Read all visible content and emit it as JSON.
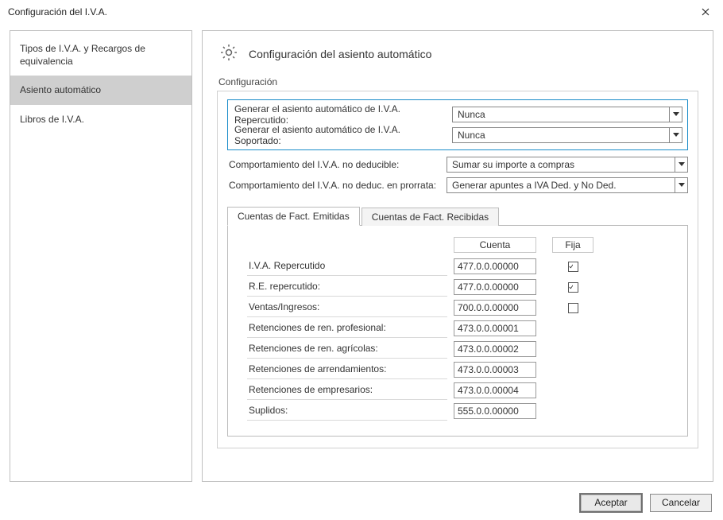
{
  "window": {
    "title": "Configuración del I.V.A."
  },
  "sidebar": {
    "items": [
      {
        "label": "Tipos de I.V.A. y Recargos de equivalencia",
        "selected": false
      },
      {
        "label": "Asiento automático",
        "selected": true
      },
      {
        "label": "Libros de I.V.A.",
        "selected": false
      }
    ]
  },
  "page": {
    "title": "Configuración del asiento automático",
    "section_label": "Configuración",
    "fields": {
      "repercutido_label": "Generar el asiento automático de I.V.A. Repercutido:",
      "repercutido_value": "Nunca",
      "soportado_label": "Generar el asiento automático de I.V.A. Soportado:",
      "soportado_value": "Nunca",
      "no_deduc_label": "Comportamiento del I.V.A. no deducible:",
      "no_deduc_value": "Sumar su importe a compras",
      "prorrata_label": "Comportamiento del I.V.A. no deduc. en prorrata:",
      "prorrata_value": "Generar apuntes a IVA Ded. y No Ded."
    },
    "tabs": [
      {
        "label": "Cuentas de Fact. Emitidas",
        "active": true
      },
      {
        "label": "Cuentas de Fact. Recibidas",
        "active": false
      }
    ],
    "columns": {
      "cuenta": "Cuenta",
      "fija": "Fija"
    },
    "accounts": [
      {
        "label": "I.V.A. Repercutido",
        "cuenta": "477.0.0.00000",
        "fija": true
      },
      {
        "label": "R.E. repercutido:",
        "cuenta": "477.0.0.00000",
        "fija": true
      },
      {
        "label": "Ventas/Ingresos:",
        "cuenta": "700.0.0.00000",
        "fija": false
      },
      {
        "label": "Retenciones de ren. profesional:",
        "cuenta": "473.0.0.00001",
        "fija": null
      },
      {
        "label": "Retenciones de ren. agrícolas:",
        "cuenta": "473.0.0.00002",
        "fija": null
      },
      {
        "label": "Retenciones de arrendamientos:",
        "cuenta": "473.0.0.00003",
        "fija": null
      },
      {
        "label": "Retenciones de empresarios:",
        "cuenta": "473.0.0.00004",
        "fija": null
      },
      {
        "label": "Suplidos:",
        "cuenta": "555.0.0.00000",
        "fija": null
      }
    ]
  },
  "buttons": {
    "accept": "Aceptar",
    "cancel": "Cancelar"
  },
  "colors": {
    "highlight_border": "#1a8cc9"
  }
}
